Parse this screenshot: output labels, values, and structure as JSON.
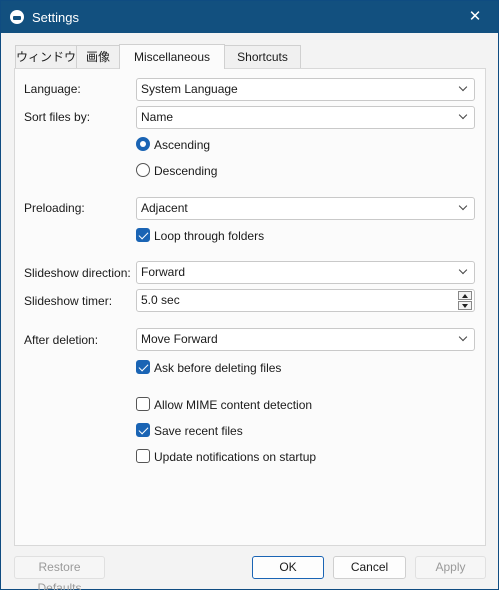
{
  "window": {
    "title": "Settings",
    "close_glyph": "✕"
  },
  "tabs": [
    {
      "label": "ウィンドウ"
    },
    {
      "label": "画像"
    },
    {
      "label": "Miscellaneous"
    },
    {
      "label": "Shortcuts"
    }
  ],
  "fields": {
    "language": {
      "label": "Language:",
      "value": "System Language"
    },
    "sort_files": {
      "label": "Sort files by:",
      "value": "Name"
    },
    "sort_order": {
      "ascending": "Ascending",
      "descending": "Descending",
      "selected": "Ascending"
    },
    "preloading": {
      "label": "Preloading:",
      "value": "Adjacent"
    },
    "loop_folders": {
      "label": "Loop through folders",
      "checked": true
    },
    "slideshow_direction": {
      "label": "Slideshow direction:",
      "value": "Forward"
    },
    "slideshow_timer": {
      "label": "Slideshow timer:",
      "value": "5.0 sec"
    },
    "after_deletion": {
      "label": "After deletion:",
      "value": "Move Forward"
    },
    "ask_before_delete": {
      "label": "Ask before deleting files",
      "checked": true
    },
    "mime_detection": {
      "label": "Allow MIME content detection",
      "checked": false
    },
    "save_recent": {
      "label": "Save recent files",
      "checked": true
    },
    "update_notifications": {
      "label": "Update notifications on startup",
      "checked": false
    }
  },
  "buttons": {
    "restore_defaults": "Restore Defaults",
    "ok": "OK",
    "cancel": "Cancel",
    "apply": "Apply"
  },
  "colors": {
    "titlebar": "#12507f",
    "accent": "#1a64b4"
  }
}
